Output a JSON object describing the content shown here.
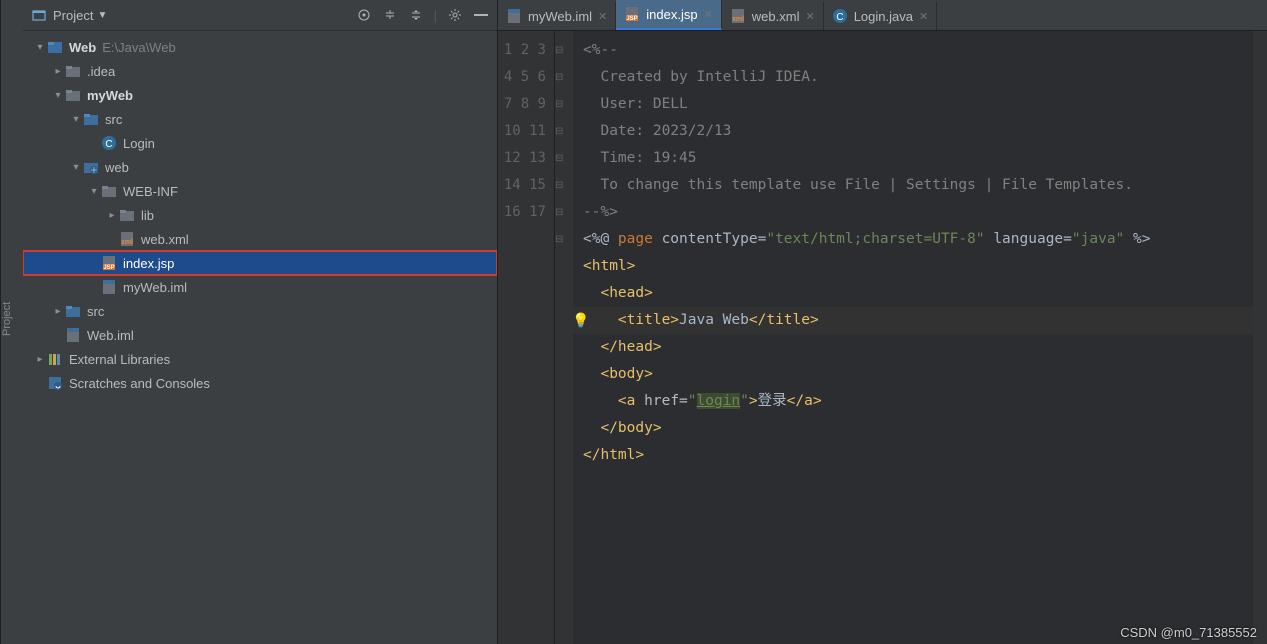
{
  "vtab": {
    "label": "Project"
  },
  "sidebar": {
    "header": {
      "title": "Project"
    },
    "tree": [
      {
        "depth": 0,
        "tw": "v",
        "icon": "module",
        "label": "Web",
        "tail": "E:\\Java\\Web",
        "bold": true
      },
      {
        "depth": 1,
        "tw": ">",
        "icon": "folder",
        "label": ".idea"
      },
      {
        "depth": 1,
        "tw": "v",
        "icon": "folder",
        "label": "myWeb",
        "bold": true
      },
      {
        "depth": 2,
        "tw": "v",
        "icon": "srcdir",
        "label": "src"
      },
      {
        "depth": 3,
        "tw": "",
        "icon": "class",
        "label": "Login"
      },
      {
        "depth": 2,
        "tw": "v",
        "icon": "webdir",
        "label": "web"
      },
      {
        "depth": 3,
        "tw": "v",
        "icon": "folder",
        "label": "WEB-INF"
      },
      {
        "depth": 4,
        "tw": ">",
        "icon": "folder",
        "label": "lib"
      },
      {
        "depth": 4,
        "tw": "",
        "icon": "xmlfile",
        "label": "web.xml"
      },
      {
        "depth": 3,
        "tw": "",
        "icon": "jspfile",
        "label": "index.jsp",
        "sel": true,
        "redbox": true
      },
      {
        "depth": 3,
        "tw": "",
        "icon": "imlfile",
        "label": "myWeb.iml"
      },
      {
        "depth": 1,
        "tw": ">",
        "icon": "srcdir",
        "label": "src"
      },
      {
        "depth": 1,
        "tw": "",
        "icon": "imlfile",
        "label": "Web.iml"
      },
      {
        "depth": 0,
        "tw": ">",
        "icon": "libs",
        "label": "External Libraries"
      },
      {
        "depth": 0,
        "tw": "",
        "icon": "scratch",
        "label": "Scratches and Consoles"
      }
    ]
  },
  "tabs": [
    {
      "icon": "imlfile",
      "label": "myWeb.iml"
    },
    {
      "icon": "jspfile",
      "label": "index.jsp",
      "active": true
    },
    {
      "icon": "xmlfile",
      "label": "web.xml"
    },
    {
      "icon": "class",
      "label": "Login.java"
    }
  ],
  "code": {
    "lines": [
      {
        "n": 1,
        "fold": "-",
        "segs": [
          {
            "t": "<%--",
            "cls": "c-comment"
          }
        ]
      },
      {
        "n": 2,
        "fold": "",
        "segs": [
          {
            "t": "  Created by IntelliJ IDEA.",
            "cls": "c-comment"
          }
        ]
      },
      {
        "n": 3,
        "fold": "",
        "segs": [
          {
            "t": "  User: DELL",
            "cls": "c-comment"
          }
        ]
      },
      {
        "n": 4,
        "fold": "",
        "segs": [
          {
            "t": "  Date: 2023/2/13",
            "cls": "c-comment"
          }
        ]
      },
      {
        "n": 5,
        "fold": "",
        "segs": [
          {
            "t": "  Time: 19:45",
            "cls": "c-comment"
          }
        ]
      },
      {
        "n": 6,
        "fold": "",
        "segs": [
          {
            "t": "  To change this template use File | Settings | File Templates.",
            "cls": "c-comment"
          }
        ]
      },
      {
        "n": 7,
        "fold": "-",
        "segs": [
          {
            "t": "--%>",
            "cls": "c-comment"
          }
        ]
      },
      {
        "n": 8,
        "fold": "",
        "segs": [
          {
            "t": "<%@ "
          },
          {
            "t": "page",
            "cls": "c-key"
          },
          {
            "t": " contentType="
          },
          {
            "t": "\"text/html;charset=UTF-8\"",
            "cls": "c-str"
          },
          {
            "t": " language="
          },
          {
            "t": "\"java\"",
            "cls": "c-str"
          },
          {
            "t": " %>"
          }
        ]
      },
      {
        "n": 9,
        "fold": "-",
        "segs": [
          {
            "t": "<html>",
            "cls": "c-tag"
          }
        ]
      },
      {
        "n": 10,
        "fold": "-",
        "segs": [
          {
            "t": "  "
          },
          {
            "t": "<head>",
            "cls": "c-tag"
          }
        ]
      },
      {
        "n": 11,
        "fold": "",
        "caret": true,
        "segs": [
          {
            "t": "    "
          },
          {
            "t": "<title>",
            "cls": "c-tag"
          },
          {
            "t": "Java Web"
          },
          {
            "t": "</title>",
            "cls": "c-tag"
          }
        ]
      },
      {
        "n": 12,
        "fold": "-",
        "segs": [
          {
            "t": "  "
          },
          {
            "t": "</head>",
            "cls": "c-tag"
          }
        ]
      },
      {
        "n": 13,
        "fold": "-",
        "segs": [
          {
            "t": "  "
          },
          {
            "t": "<body>",
            "cls": "c-tag"
          }
        ]
      },
      {
        "n": 14,
        "fold": "",
        "segs": [
          {
            "t": "    "
          },
          {
            "t": "<a ",
            "cls": "c-tag"
          },
          {
            "t": "href=",
            "cls": "c-attr"
          },
          {
            "t": "\"",
            "cls": "c-str"
          },
          {
            "t": "login",
            "cls": "c-link"
          },
          {
            "t": "\"",
            "cls": "c-str"
          },
          {
            "t": ">",
            "cls": "c-tag"
          },
          {
            "t": "登录"
          },
          {
            "t": "</a>",
            "cls": "c-tag"
          }
        ]
      },
      {
        "n": 15,
        "fold": "-",
        "segs": [
          {
            "t": "  "
          },
          {
            "t": "</body>",
            "cls": "c-tag"
          }
        ]
      },
      {
        "n": 16,
        "fold": "-",
        "segs": [
          {
            "t": "</html>",
            "cls": "c-tag"
          }
        ]
      },
      {
        "n": 17,
        "fold": "",
        "segs": [
          {
            "t": ""
          }
        ]
      }
    ]
  },
  "watermark": "CSDN @m0_71385552"
}
